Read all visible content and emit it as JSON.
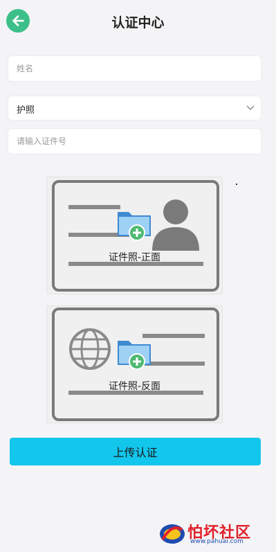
{
  "header": {
    "title": "认证中心",
    "back_icon": "arrow-left-icon"
  },
  "form": {
    "name_placeholder": "姓名",
    "name_value": "",
    "doc_type_selected": "护照",
    "id_number_placeholder": "请输入证件号",
    "id_number_value": ""
  },
  "uploads": {
    "front_label": "证件照-正面",
    "back_label": "证件照-反面"
  },
  "submit_label": "上传认证",
  "watermark": {
    "text": "怕坏社区",
    "url": "www.pahuai.com"
  },
  "colors": {
    "accent": "#12c6ec",
    "back_button": "#3dbf8a",
    "watermark_red": "#e0202a"
  }
}
